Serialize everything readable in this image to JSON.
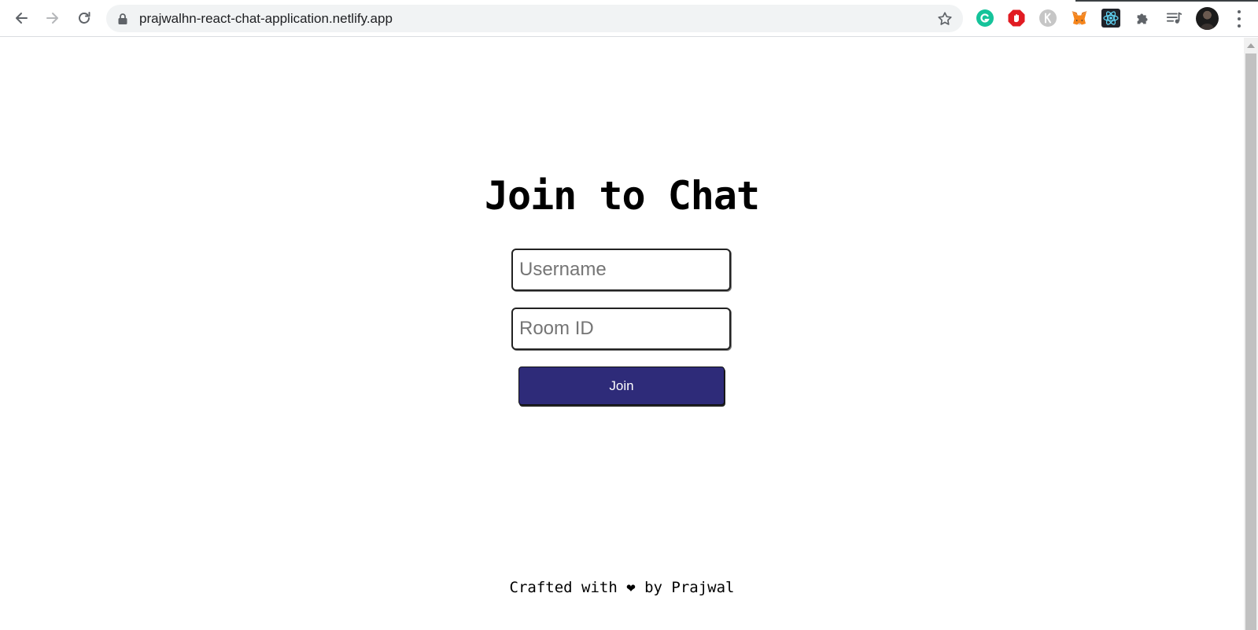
{
  "browser": {
    "url": "prajwalhn-react-chat-application.netlify.app",
    "toolbar_icons": {
      "back": "arrow-left-icon",
      "forward": "arrow-right-icon",
      "reload": "reload-icon",
      "lock": "lock-icon",
      "bookmark": "star-icon",
      "menu": "kebab-menu-icon"
    },
    "extensions": [
      "grammarly-icon",
      "adblock-icon",
      "k-icon",
      "metamask-icon",
      "react-devtools-icon",
      "puzzle-icon",
      "media-control-icon"
    ]
  },
  "page": {
    "title": "Join to Chat",
    "username_placeholder": "Username",
    "room_placeholder": "Room ID",
    "join_label": "Join",
    "footer": "Crafted with ❤ by Prajwal"
  },
  "colors": {
    "join_button_bg": "#2e2b79",
    "page_bg": "#ffffff"
  }
}
